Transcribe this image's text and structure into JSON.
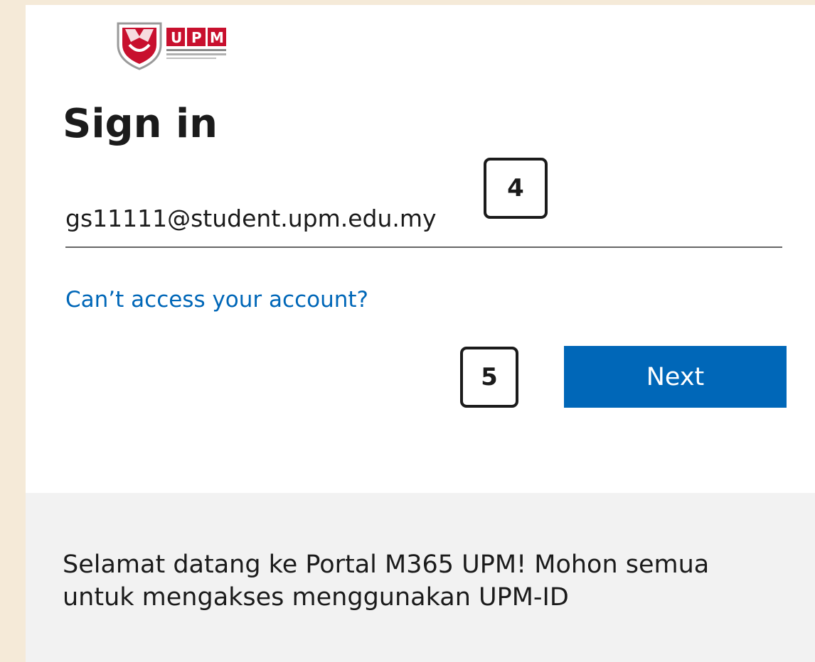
{
  "brand": {
    "logo_alt": "UPM",
    "logo_text": "UPM",
    "primary_color": "#0067b8",
    "logo_red": "#c8102e"
  },
  "signin": {
    "title": "Sign in",
    "email_value": "gs11111@student.upm.edu.my",
    "cant_access_link": "Can’t access your account?",
    "next_button": "Next"
  },
  "annotations": {
    "step_email": "4",
    "step_next": "5"
  },
  "footer": {
    "message": "Selamat datang ke Portal M365 UPM! Mohon semua untuk mengakses menggunakan UPM-ID"
  }
}
